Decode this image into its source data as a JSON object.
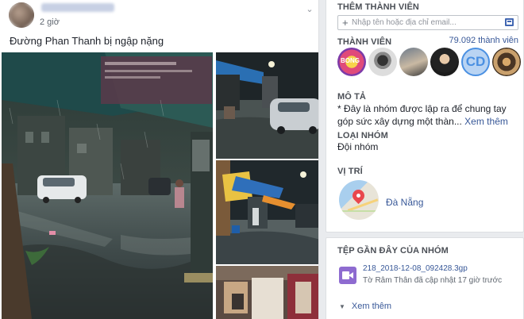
{
  "post": {
    "timestamp": "2 giờ",
    "text": "Đường Phan Thanh bị ngập nặng",
    "menu_icon": "chevron-down-icon"
  },
  "side": {
    "add_members": {
      "title": "THÊM THÀNH VIÊN",
      "placeholder": "Nhập tên hoặc địa chỉ email...",
      "icon": "address-book-icon"
    },
    "members": {
      "title": "THÀNH VIÊN",
      "count": "79.092 thành viên",
      "avatar_texts": [
        "BONG",
        "CD"
      ]
    },
    "description": {
      "title": "MÔ TẢ",
      "text": "* Đây là nhóm được lập ra để chung tay góp sức xây dựng một thàn...",
      "more": "Xem thêm"
    },
    "group_type": {
      "title": "LOẠI NHÓM",
      "value": "Đội nhóm"
    },
    "location": {
      "title": "VỊ TRÍ",
      "value": "Đà Nẵng"
    },
    "files": {
      "title": "TỆP GẦN ĐÂY CỦA NHÓM",
      "name": "218_2018-12-08_092428.3gp",
      "meta": "Tờ Râm Thân đã cập nhật 17 giờ trước",
      "more": "Xem thêm"
    }
  },
  "colors": {
    "link": "#385898",
    "accent": "#4267b2",
    "background": "#e9ebee"
  }
}
